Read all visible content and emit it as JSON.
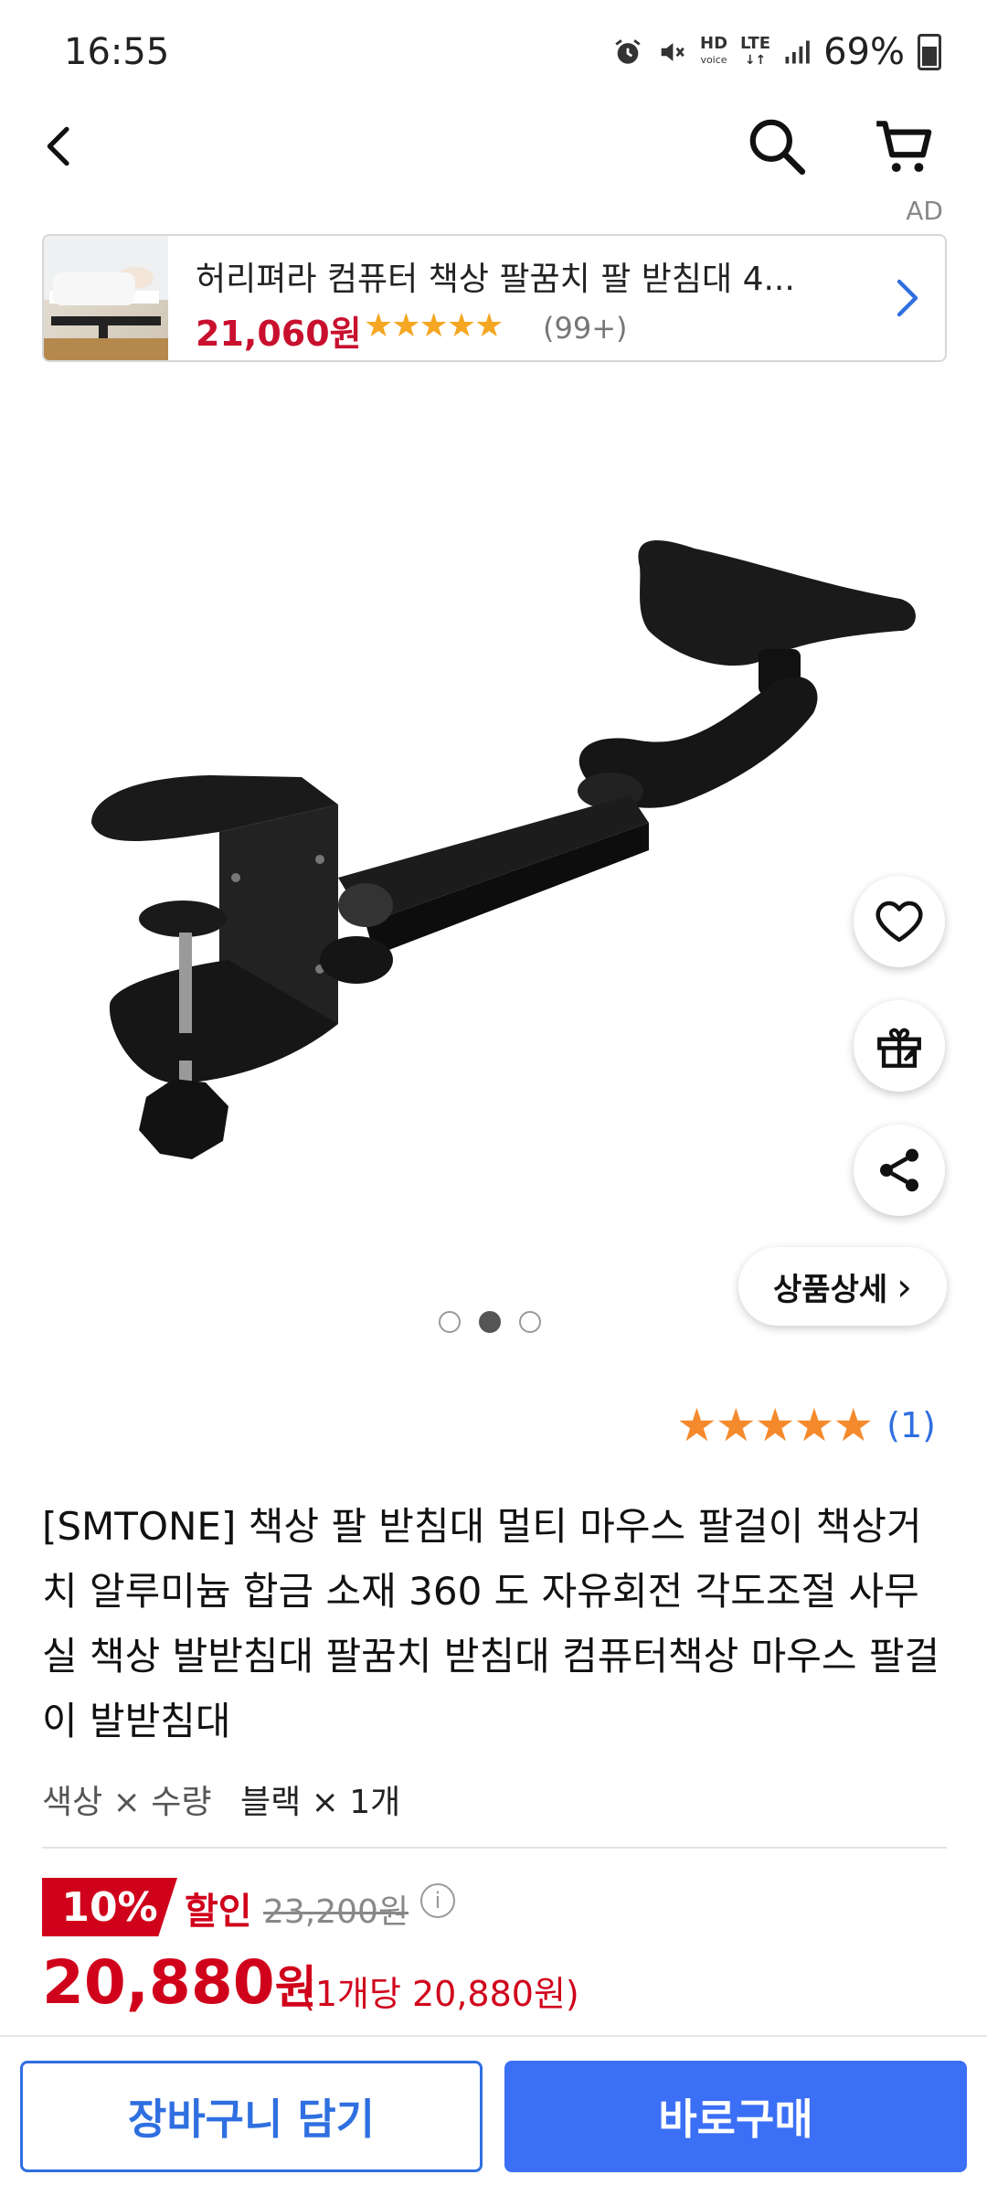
{
  "status_bar": {
    "time": "16:55",
    "hd_label": "HD",
    "voice_label": "voice",
    "lte_label": "LTE",
    "battery": "69%",
    "icons": [
      "alarm-icon",
      "mute-icon",
      "hd-voice-icon",
      "lte-icon",
      "signal-icon",
      "battery-icon"
    ]
  },
  "header": {
    "icons": [
      "back-arrow-icon",
      "search-icon",
      "cart-icon"
    ]
  },
  "ad": {
    "tag": "AD",
    "title": "허리펴라 컴퓨터 책상 팔꿈치 팔 받침대 4...",
    "price": "21,060원",
    "stars": "★★★★★",
    "rating": 4.5,
    "review_count": "(99+)"
  },
  "carousel": {
    "pages": 3,
    "active_index": 1
  },
  "actions": {
    "icons": [
      "heart-icon",
      "gift-icon",
      "share-icon"
    ],
    "detail_label": "상품상세",
    "detail_arrow": "›"
  },
  "rating": {
    "stars": "★★★★★",
    "value": 5,
    "count": "(1)"
  },
  "product": {
    "title": "[SMTONE] 책상 팔 받침대 멀티 마우스 팔걸이 책상거치 알루미늄 합금 소재 360 도 자유회전 각도조절 사무실 책상 발받침대 팔꿈치 받침대 컴퓨터책상 마우스 팔걸이 발받침대",
    "option_key": "색상 × 수량",
    "option_value": "블랙 × 1개"
  },
  "price": {
    "discount_badge": "10%",
    "discount_label": "할인",
    "original": "23,200원",
    "info_mark": "i",
    "amount": "20,880",
    "currency": "원",
    "unit": "(1개당 20,880원)"
  },
  "bottom_bar": {
    "cart_label": "장바구니 담기",
    "buy_label": "바로구매"
  },
  "colors": {
    "accent_blue": "#3b6ff5",
    "price_red": "#d0021b",
    "star_orange": "#f58a2c"
  }
}
